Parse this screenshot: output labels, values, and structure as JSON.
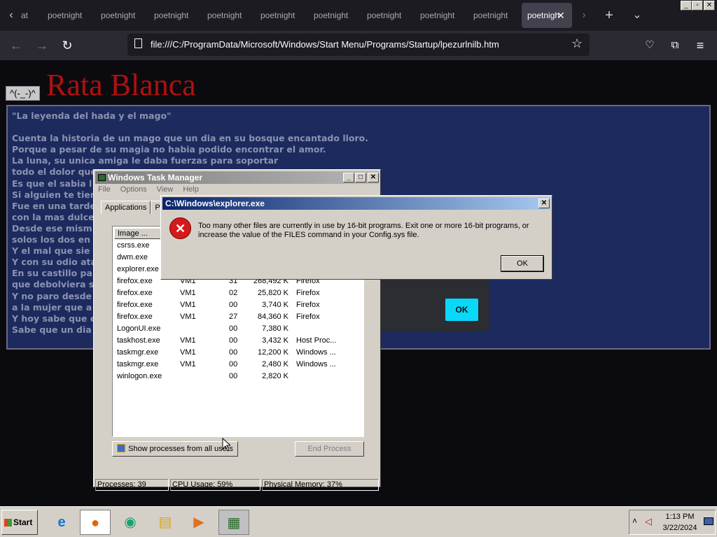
{
  "browser": {
    "tabs": [
      "at",
      "poetnight",
      "poetnight",
      "poetnight",
      "poetnight",
      "poetnight",
      "poetnight",
      "poetnight",
      "poetnight",
      "poetnight"
    ],
    "active_tab": "poetnigh",
    "url": "file:///C:/ProgramData/Microsoft/Windows/Start Menu/Programs/Startup/lpezurlnilb.htm"
  },
  "page": {
    "emote": "^(-_-)^",
    "heading": "Rata Blanca",
    "poem": "\"La leyenda del hada y el mago\"\n\nCuenta la historia de un mago que un dia en su bosque encantado lloro.\nPorque a pesar de su magia no habia podido encontrar el amor.\nLa luna, su unica amiga le daba fuerzas para soportar\ntodo el dolor que\nEs que el sabia l                                                            lo.\nSi alguien te tier                                                           corle\nFue en una tarde\ncon la mas dulce\nDesde ese mism\nsolos los dos en\nY el mal que sie\nY con su odio ata\nEn su castillo pa\nque debolviera s\nY no paro desde\na la mujer que a\nY hoy sabe que e\nSabe que un dia",
    "modal_ok": "OK"
  },
  "task_manager": {
    "title": "Windows Task Manager",
    "menu": [
      "File",
      "Options",
      "View",
      "Help"
    ],
    "tabs": [
      "Applications",
      "Pr"
    ],
    "column": "Image ...",
    "processes": [
      {
        "name": "csrss.exe",
        "user": "",
        "cpu": "",
        "mem": "",
        "desc": ""
      },
      {
        "name": "dwm.exe",
        "user": "",
        "cpu": "",
        "mem": "",
        "desc": ""
      },
      {
        "name": "explorer.exe",
        "user": "",
        "cpu": "",
        "mem": "",
        "desc": ""
      },
      {
        "name": "firefox.exe",
        "user": "VM1",
        "cpu": "31",
        "mem": "268,492 K",
        "desc": "Firefox"
      },
      {
        "name": "firefox.exe",
        "user": "VM1",
        "cpu": "02",
        "mem": "25,820 K",
        "desc": "Firefox"
      },
      {
        "name": "firefox.exe",
        "user": "VM1",
        "cpu": "00",
        "mem": "3,740 K",
        "desc": "Firefox"
      },
      {
        "name": "firefox.exe",
        "user": "VM1",
        "cpu": "27",
        "mem": "84,360 K",
        "desc": "Firefox"
      },
      {
        "name": "LogonUI.exe",
        "user": "",
        "cpu": "00",
        "mem": "7,380 K",
        "desc": ""
      },
      {
        "name": "taskhost.exe",
        "user": "VM1",
        "cpu": "00",
        "mem": "3,432 K",
        "desc": "Host Proc..."
      },
      {
        "name": "taskmgr.exe",
        "user": "VM1",
        "cpu": "00",
        "mem": "12,200 K",
        "desc": "Windows ..."
      },
      {
        "name": "taskmgr.exe",
        "user": "VM1",
        "cpu": "00",
        "mem": "2,480 K",
        "desc": "Windows ..."
      },
      {
        "name": "winlogon.exe",
        "user": "",
        "cpu": "00",
        "mem": "2,820 K",
        "desc": ""
      }
    ],
    "show_all": "Show processes from all users",
    "end_process": "End Process",
    "status": {
      "processes": "Processes: 39",
      "cpu": "CPU Usage: 59%",
      "memory": "Physical Memory: 37%"
    }
  },
  "error_dialog": {
    "title": "C:\\Windows\\explorer.exe",
    "message_line1": "Too many other files are currently in use by 16-bit programs. Exit one or more 16-bit programs, or",
    "message_line2": "increase the value of the FILES command in your Config.sys file.",
    "ok": "OK"
  },
  "taskbar": {
    "start": "Start",
    "time": "1:13 PM",
    "date": "3/22/2024"
  }
}
